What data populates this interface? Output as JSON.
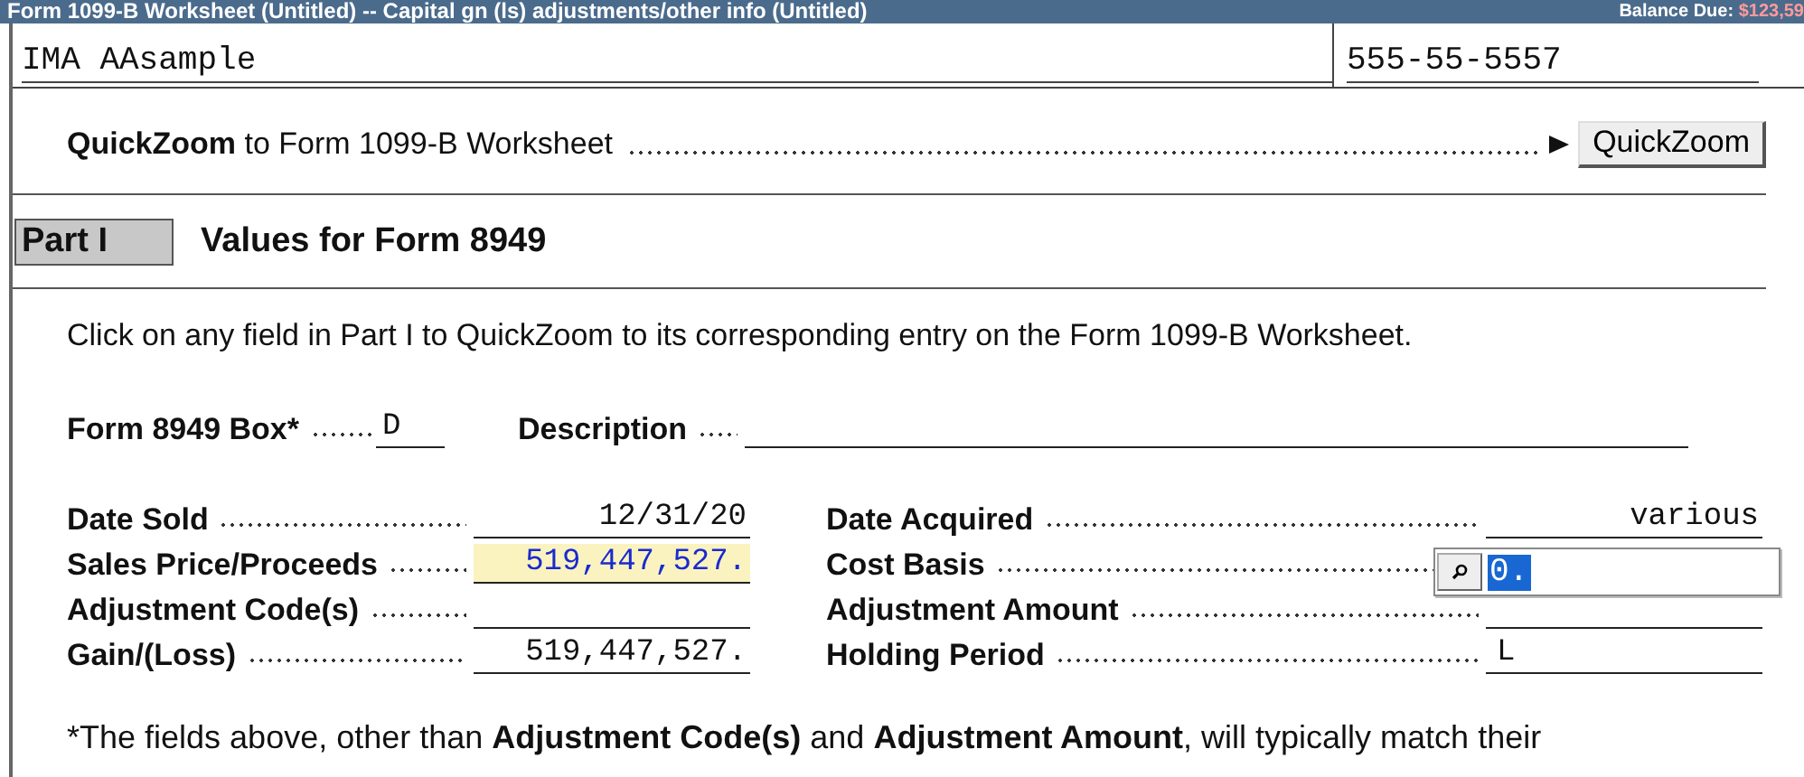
{
  "title_bar": {
    "title": "Form 1099-B Worksheet (Untitled) -- Capital gn (ls) adjustments/other info (Untitled)",
    "balance_label": "Balance Due:",
    "balance_amount": "$123,59"
  },
  "header": {
    "name": "IMA AAsample",
    "ssn": "555-55-5557"
  },
  "quickzoom": {
    "text": "**QuickZoom** to Form 1099-B Worksheet",
    "button": "QuickZoom"
  },
  "part": {
    "badge": "Part I",
    "title": "Values for Form 8949"
  },
  "instruction": "Click on any field in Part I to QuickZoom to its corresponding entry on the Form 1099-B Worksheet.",
  "box_row": {
    "label": "Form 8949 Box*",
    "value": "D",
    "description_label": "Description"
  },
  "left_fields": [
    {
      "label": "Date Sold",
      "value": "12/31/20",
      "highlighted": false
    },
    {
      "label": "Sales Price/Proceeds",
      "value": "519,447,527.",
      "highlighted": true
    },
    {
      "label": "Adjustment Code(s)",
      "highlighted": false
    },
    {
      "label": "Gain/(Loss)",
      "value": "519,447,527.",
      "highlighted": false
    }
  ],
  "right_fields": [
    {
      "label": "Date Acquired",
      "value": "various",
      "editing": false
    },
    {
      "label": "Cost Basis",
      "value": "0.",
      "editing": true
    },
    {
      "label": "Adjustment Amount",
      "editing": false
    },
    {
      "label": "Holding Period",
      "value": "L",
      "editing": false
    }
  ],
  "footnote": "*The fields above, other than **Adjustment Code(s)** and **Adjustment Amount**, will typically match their"
}
